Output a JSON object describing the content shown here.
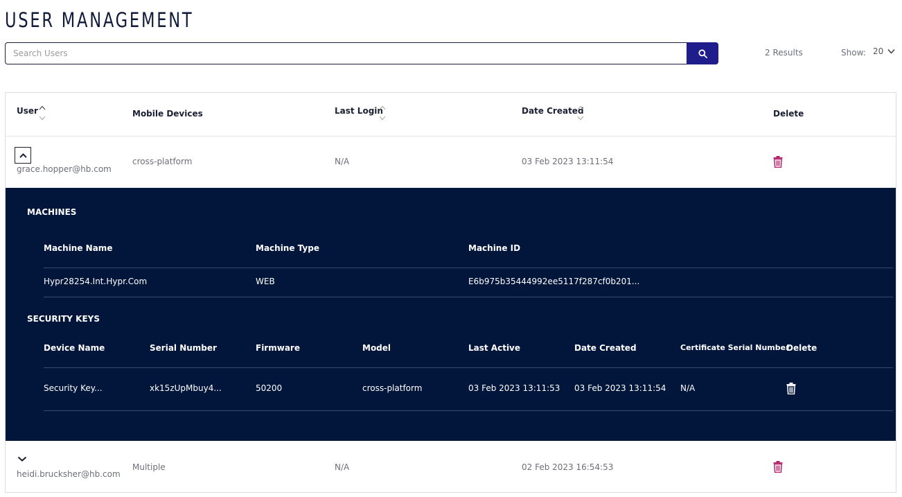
{
  "page": {
    "title": "USER MANAGEMENT"
  },
  "search": {
    "placeholder": "Search Users",
    "value": ""
  },
  "results": {
    "count_label": "2 Results"
  },
  "show": {
    "label": "Show:",
    "value": "20"
  },
  "table": {
    "headers": {
      "user": "User",
      "mobile_devices": "Mobile Devices",
      "last_login": "Last Login",
      "date_created": "Date Created",
      "delete": "Delete"
    },
    "rows": [
      {
        "email": "grace.hopper@hb.com",
        "mobile_devices": "cross-platform",
        "last_login": "N/A",
        "date_created": "03 Feb 2023 13:11:54",
        "expanded": true
      },
      {
        "email": "heidi.brucksher@hb.com",
        "mobile_devices": "Multiple",
        "last_login": "N/A",
        "date_created": "02 Feb 2023 16:54:53",
        "expanded": false
      }
    ]
  },
  "details": {
    "machines": {
      "title": "MACHINES",
      "headers": {
        "name": "Machine Name",
        "type": "Machine Type",
        "id": "Machine ID"
      },
      "rows": [
        {
          "name": "Hypr28254.Int.Hypr.Com",
          "type": "WEB",
          "id": "E6b975b35444992ee5117f287cf0b201..."
        }
      ]
    },
    "security_keys": {
      "title": "SECURITY KEYS",
      "headers": {
        "device_name": "Device Name",
        "serial_number": "Serial Number",
        "firmware": "Firmware",
        "model": "Model",
        "last_active": "Last Active",
        "date_created": "Date Created",
        "cert_serial": "Certificate Serial Number",
        "delete": "Delete"
      },
      "rows": [
        {
          "device_name": "Security Key...",
          "serial_number": "xk15zUpMbuy4...",
          "firmware": "50200",
          "model": "cross-platform",
          "last_active": "03 Feb 2023 13:11:53",
          "date_created": "03 Feb 2023 13:11:54",
          "cert_serial": "N/A"
        }
      ]
    }
  },
  "colors": {
    "navy": "#02163c",
    "accent": "#1f1c8c",
    "trash": "#b3246b"
  },
  "icons": [
    "search-icon",
    "chevron-down-icon",
    "sort-icon",
    "chevron-up-icon",
    "trash-icon"
  ]
}
